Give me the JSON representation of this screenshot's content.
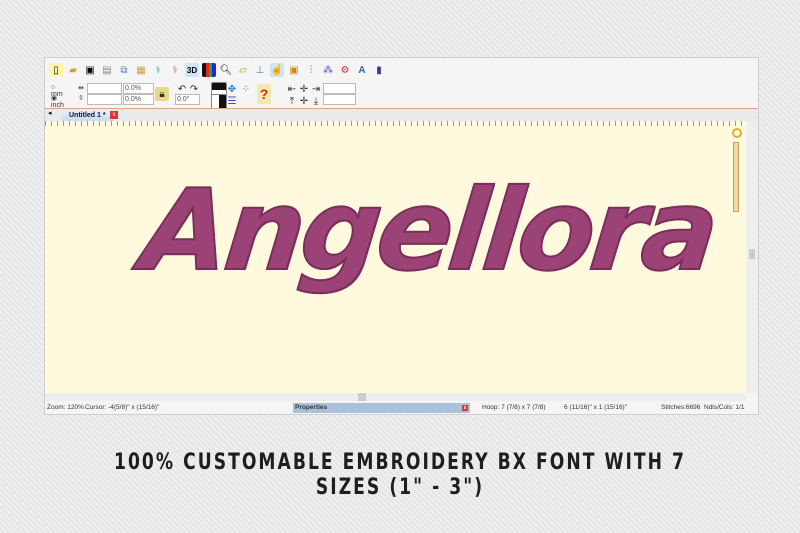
{
  "toolbar": {
    "icons": [
      "new-icon",
      "open-icon",
      "save-icon",
      "print-icon",
      "copy-icon",
      "paste-icon",
      "stitch-icon",
      "redo-stitch-icon",
      "3d-icon",
      "color-icon",
      "zoom-icon",
      "measure-icon",
      "hoop-icon",
      "hand-icon",
      "frame-icon",
      "thread-icon",
      "pattern-icon",
      "settings-icon",
      "text-icon",
      "export-icon"
    ],
    "label_3d": "3D"
  },
  "units": {
    "mm": "mm",
    "inch": "inch",
    "selected": "inch"
  },
  "fields": {
    "width": "",
    "height": "",
    "scale_x": "0.0%",
    "scale_y": "0.0%",
    "rotation": "0.0°",
    "align_1": "",
    "align_2": ""
  },
  "tab": {
    "label": "Untitled 1 *",
    "close": "x"
  },
  "design": {
    "text": "Angellora",
    "thread_color": "#9b4376"
  },
  "status": {
    "zoom": "Zoom: 120%",
    "cursor": "Cursor: -4(5/8)\" x (15/16)\"",
    "properties": "Properties",
    "properties_close": "x",
    "hoop": "Hoop: 7 (7/8) x 7 (7/8)",
    "size": "6 (11/16)\" x 1 (15/16)\"",
    "stitches": "Stitches:6696",
    "ndls": "Ndls/Cols: 1/1"
  },
  "caption": "100% CUSTOMABLE EMBROIDERY BX FONT WITH 7 SIZES (1\" -  3\")"
}
